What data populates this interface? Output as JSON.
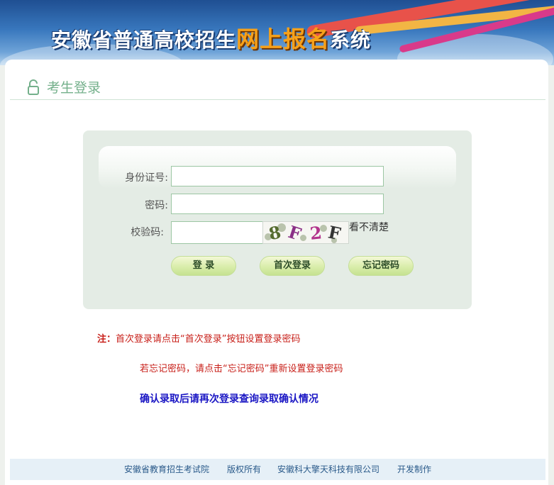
{
  "banner": {
    "title_part1": "安徽省普通高校招生",
    "title_highlight": "网上报名",
    "title_part2": "系统"
  },
  "section": {
    "title": "考生登录",
    "icon": "lock-icon"
  },
  "form": {
    "id_label": "身份证号:",
    "id_value": "",
    "password_label": "密码:",
    "password_value": "",
    "captcha_label": "校验码:",
    "captcha_value": "",
    "captcha_chars": [
      "8",
      "F",
      "2",
      "F"
    ],
    "unclear_link": "看不清楚"
  },
  "buttons": {
    "login": "登 录",
    "first_login": "首次登录",
    "forgot_password": "忘记密码"
  },
  "notes": {
    "prefix": "注：",
    "note1": "首次登录请点击“首次登录”按钮设置登录密码",
    "note2": "若忘记密码，请点击“忘记密码”重新设置登录密码",
    "note3": "确认录取后请再次登录查询录取确认情况"
  },
  "footer": {
    "org": "安徽省教育招生考试院",
    "rights": "版权所有",
    "company": "安徽科大擎天科技有限公司",
    "dev": "开发制作"
  },
  "colors": {
    "accent_green": "#74b08b",
    "panel_bg": "#e4ece5",
    "note_red": "#c8201a",
    "note_blue": "#1a16c4",
    "highlight_orange": "#f7a11a"
  }
}
